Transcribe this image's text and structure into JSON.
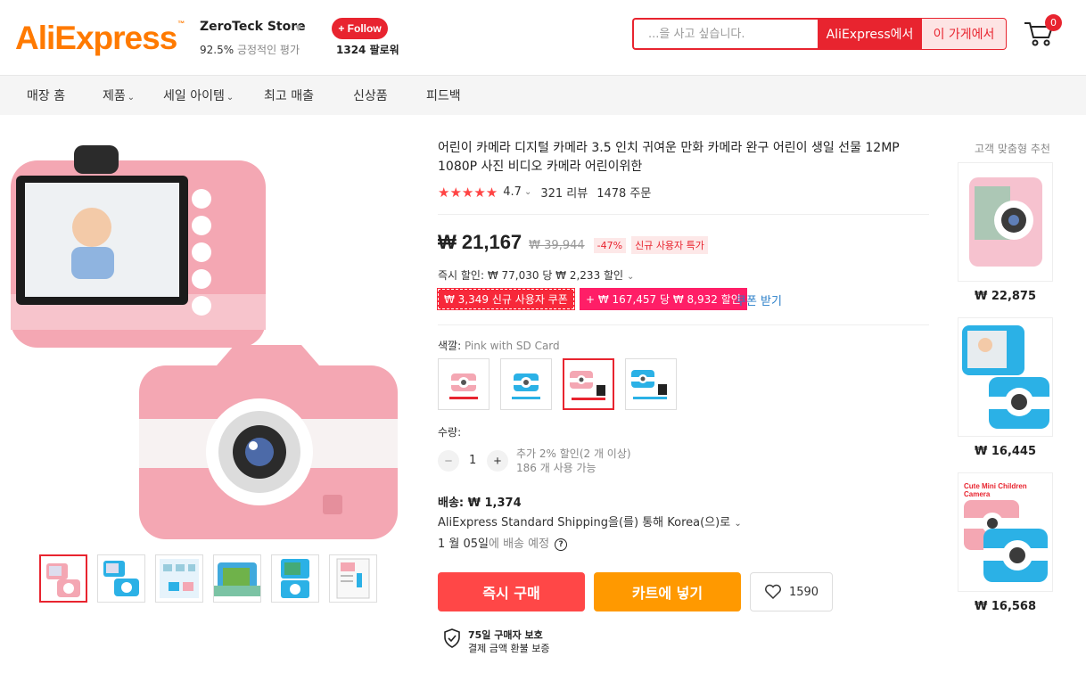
{
  "header": {
    "logo": "AliExpress",
    "store_name": "ZeroTeck Store",
    "rating_pct": "92.5%",
    "rating_text": "긍정적인 평가",
    "follow_label": "+ Follow",
    "followers": "1324 팔로워",
    "search_placeholder": "...을 사고 싶습니다.",
    "search_ali_label": "AliExpress에서",
    "search_store_label": "이 가게에서",
    "cart_count": "0"
  },
  "nav": {
    "home": "매장 홈",
    "products": "제품",
    "sale": "세일 아이템",
    "bestseller": "최고 매출",
    "new": "신상품",
    "feedback": "피드백"
  },
  "product": {
    "title": "어린이 카메라 디지털 카메라 3.5 인치 귀여운 만화 카메라 완구 어린이 생일 선물 12MP 1080P 사진 비디오 카메라 어린이위한",
    "rating": "4.7",
    "reviews": "321 리뷰",
    "orders": "1478 주문",
    "price": "₩ 21,167",
    "old_price": "₩ 39,944",
    "discount": "-47%",
    "new_user_tag": "신규 사용자 특가",
    "instant_discount": "즉시 할인: ₩ 77,030 당 ₩ 2,233 할인",
    "coupon1": "₩ 3,349 신규 사용자 쿠폰",
    "coupon2": "+ ₩ 167,457 당 ₩ 8,932 할인",
    "coupon_link": "쿠폰 받기",
    "color_label": "색깔:",
    "color_value": "Pink with SD Card",
    "qty_label": "수량:",
    "qty_value": "1",
    "qty_note1": "추가 2% 할인(2 개 이상)",
    "qty_note2": "186 개 사용 가능",
    "ship_price": "배송: ₩ 1,374",
    "ship_method": "AliExpress Standard Shipping을(를) 통해 Korea(으)로",
    "ship_date_strong": "1 월 05일",
    "ship_date_rest": "에 배송 예정",
    "buy_label": "즉시 구매",
    "cart_label": "카트에 넣기",
    "wish_count": "1590",
    "protect_title": "75일 구매자 보호",
    "protect_sub": "결제 금액 환불 보증"
  },
  "recommendations": {
    "title": "고객 맞춤형 추천",
    "items": [
      {
        "price": "₩ 22,875"
      },
      {
        "price": "₩ 16,445"
      },
      {
        "price": "₩ 16,568",
        "caption": "Cute Mini Children Camera"
      }
    ]
  },
  "colors": {
    "brand_red": "#e8242f",
    "orange": "#ff9900",
    "pink": "#f4a7b3",
    "blue": "#2bb1e6"
  }
}
